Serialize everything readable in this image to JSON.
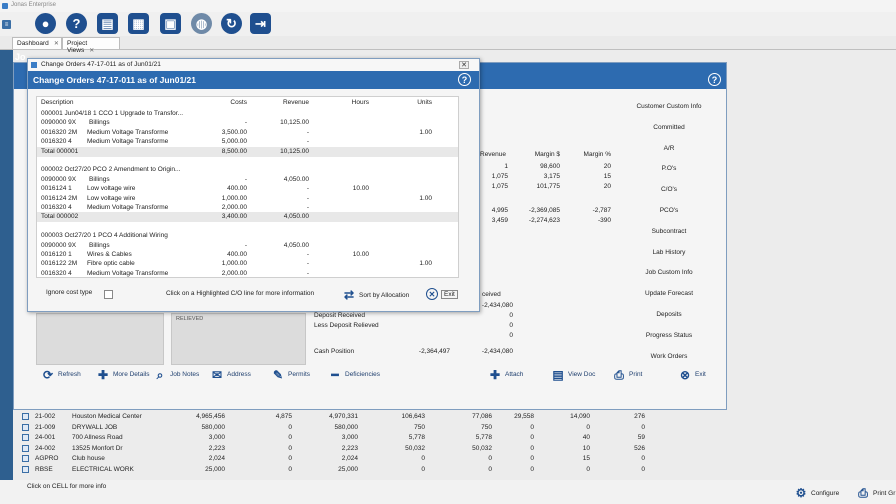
{
  "app": {
    "title": "Jonas Enterprise"
  },
  "tabs": [
    {
      "label": "Dashboard"
    },
    {
      "label": "Project Views"
    }
  ],
  "main_window": {
    "title_partial": "Jo"
  },
  "side_menu": [
    "Customer Custom Info",
    "Committed",
    "A/R",
    "P.O's",
    "C/O's",
    "PCO's",
    "Subcontract",
    "Lab History",
    "Job Custom Info",
    "Update Forecast",
    "Deposits",
    "Progress Status",
    "Work Orders"
  ],
  "revenue_table": {
    "headers": [
      "Revenue",
      "Margin $",
      "Margin %"
    ],
    "rows": [
      [
        "1",
        "98,600",
        "20"
      ],
      [
        "1,075",
        "3,175",
        "15"
      ],
      [
        "1,075",
        "101,775",
        "20"
      ],
      [
        "4,995",
        "-2,369,085",
        "-2,787"
      ],
      [
        "3,459",
        "-2,274,623",
        "-390"
      ]
    ]
  },
  "cash": {
    "received_label": "Received",
    "received_frag": "ceived",
    "rows": [
      {
        "label": "",
        "a": "-2,434,080",
        "b": "-2,434,080"
      },
      {
        "label": "Deposit Received",
        "a": "",
        "b": "0"
      },
      {
        "label": "Less Deposit Relieved",
        "a": "",
        "b": "0"
      },
      {
        "label": "",
        "a": "",
        "b": "0"
      },
      {
        "label": "Cash Position",
        "a": "-2,364,497",
        "b": "-2,434,080"
      }
    ],
    "relieved_frag": "RELIEVED"
  },
  "bottom_buttons": [
    {
      "label": "Refresh",
      "icon": "refresh-icon"
    },
    {
      "label": "More Details",
      "icon": "plus-icon"
    },
    {
      "label": "Job Notes",
      "icon": "search-icon"
    },
    {
      "label": "Address",
      "icon": "envelope-icon"
    },
    {
      "label": "Permits",
      "icon": "pencil-icon"
    },
    {
      "label": "Deficiencies",
      "icon": "minus-icon"
    },
    {
      "label": "Attach",
      "icon": "plus-icon"
    },
    {
      "label": "View Doc",
      "icon": "document-icon"
    },
    {
      "label": "Print",
      "icon": "printer-icon"
    },
    {
      "label": "Exit",
      "icon": "close-icon"
    }
  ],
  "job_grid": {
    "rows": [
      [
        "21-002",
        "Houston Medical Center",
        "4,965,456",
        "4,875",
        "4,970,331",
        "106,643",
        "77,086",
        "29,558",
        "14,090",
        "276"
      ],
      [
        "21-009",
        "DRYWALL JOB",
        "580,000",
        "0",
        "580,000",
        "750",
        "750",
        "0",
        "0",
        "0"
      ],
      [
        "24-001",
        "700 Allness Road",
        "3,000",
        "0",
        "3,000",
        "5,778",
        "5,778",
        "0",
        "40",
        "59"
      ],
      [
        "24-002",
        "13525 Monfort Dr",
        "2,223",
        "0",
        "2,223",
        "50,032",
        "50,032",
        "0",
        "10",
        "526"
      ],
      [
        "AGPRO",
        "Club house",
        "2,024",
        "0",
        "2,024",
        "0",
        "0",
        "0",
        "15",
        "0"
      ],
      [
        "RBSE",
        "ELECTRICAL WORK",
        "25,000",
        "0",
        "25,000",
        "0",
        "0",
        "0",
        "0",
        "0"
      ]
    ]
  },
  "status": {
    "left": "Click on CELL for more info",
    "configure": "Configure",
    "print_grid": "Print Gr"
  },
  "dialog": {
    "outer_title": "Change Orders 47-17-011 as of Jun01/21",
    "title": "Change Orders 47-17-011 as of Jun01/21",
    "headers": [
      "Description",
      "Costs",
      "Revenue",
      "Hours",
      "Units"
    ],
    "rows": [
      {
        "type": "group",
        "desc": "000001 Jun04/18 1 CCO 1 Upgrade to Transfor...",
        "costs": "",
        "revenue": "",
        "hours": "",
        "units": ""
      },
      {
        "type": "line",
        "desc": "0090000 9X",
        "sub": "Billings",
        "costs": "-",
        "revenue": "10,125.00",
        "hours": "",
        "units": ""
      },
      {
        "type": "line",
        "desc": "0016320 2M",
        "sub": "Medium Voltage Transforme",
        "costs": "3,500.00",
        "revenue": "-",
        "hours": "",
        "units": "1.00"
      },
      {
        "type": "line",
        "desc": "0016320 4",
        "sub": "Medium Voltage Transforme",
        "costs": "5,000.00",
        "revenue": "-",
        "hours": "",
        "units": ""
      },
      {
        "type": "total",
        "desc": "Total 000001",
        "costs": "8,500.00",
        "revenue": "10,125.00",
        "hours": "",
        "units": ""
      },
      {
        "type": "blank"
      },
      {
        "type": "group",
        "desc": "000002 Oct27/20  PCO 2 Amendment to Origin...",
        "costs": "",
        "revenue": "",
        "hours": "",
        "units": ""
      },
      {
        "type": "line",
        "desc": "0090000 9X",
        "sub": "Billings",
        "costs": "-",
        "revenue": "4,050.00",
        "hours": "",
        "units": ""
      },
      {
        "type": "line",
        "desc": "0016124 1",
        "sub": "Low voltage wire",
        "costs": "400.00",
        "revenue": "-",
        "hours": "10.00",
        "units": ""
      },
      {
        "type": "line",
        "desc": "0016124 2M",
        "sub": "Low voltage wire",
        "costs": "1,000.00",
        "revenue": "-",
        "hours": "",
        "units": "1.00"
      },
      {
        "type": "line",
        "desc": "0016320 4",
        "sub": "Medium Voltage Transforme",
        "costs": "2,000.00",
        "revenue": "-",
        "hours": "",
        "units": ""
      },
      {
        "type": "total",
        "desc": "Total 000002",
        "costs": "3,400.00",
        "revenue": "4,050.00",
        "hours": "",
        "units": ""
      },
      {
        "type": "blank"
      },
      {
        "type": "group",
        "desc": "000003 Oct27/20 1 PCO 4 Additional Wiring",
        "costs": "",
        "revenue": "",
        "hours": "",
        "units": ""
      },
      {
        "type": "line",
        "desc": "0090000 9X",
        "sub": "Billings",
        "costs": "-",
        "revenue": "4,050.00",
        "hours": "",
        "units": ""
      },
      {
        "type": "line",
        "desc": "0016120 1",
        "sub": "Wires & Cables",
        "costs": "400.00",
        "revenue": "-",
        "hours": "10.00",
        "units": ""
      },
      {
        "type": "line",
        "desc": "0016122 2M",
        "sub": "Fibre optic cable",
        "costs": "1,000.00",
        "revenue": "-",
        "hours": "",
        "units": "1.00"
      },
      {
        "type": "line",
        "desc": "0016320 4",
        "sub": "Medium Voltage Transforme",
        "costs": "2,000.00",
        "revenue": "-",
        "hours": "",
        "units": ""
      }
    ],
    "ignore_label": "Ignore cost type",
    "hint": "Click on a Highlighted C/O line for more information",
    "sort_label": "Sort by Allocation",
    "exit_label": "Exit"
  },
  "colors": {
    "accent": "#2d6bb0",
    "navy": "#1f3f6e"
  }
}
